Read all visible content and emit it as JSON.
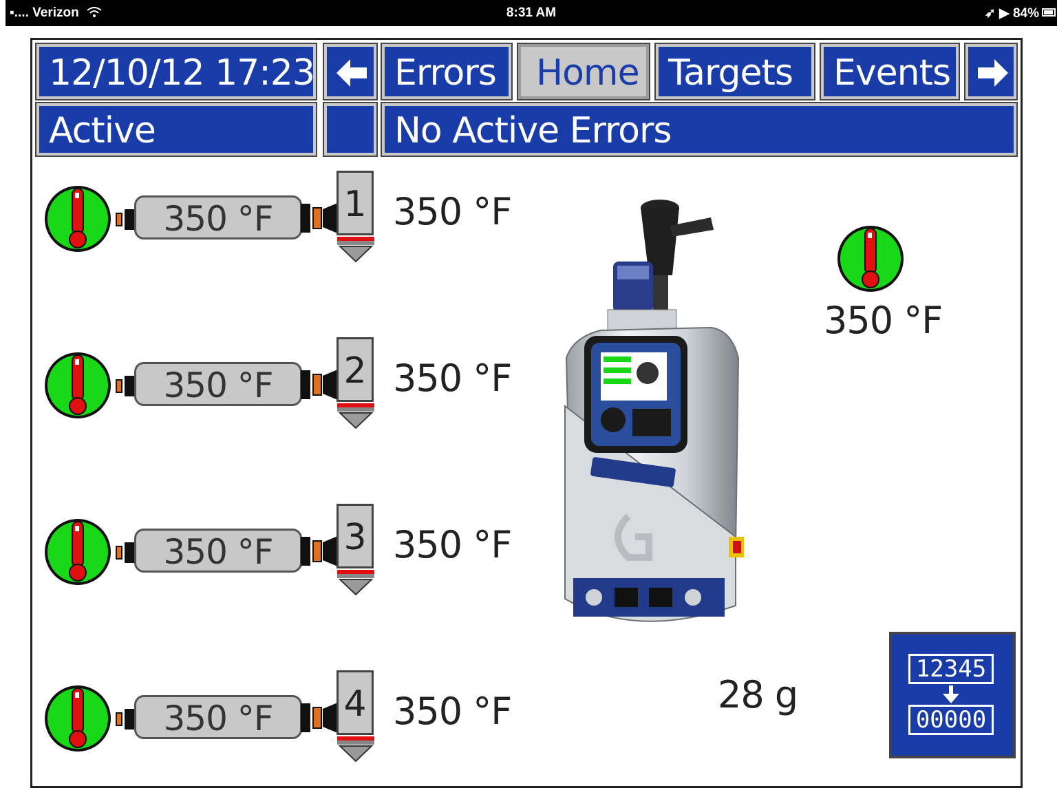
{
  "status_bar": {
    "carrier": "Verizon",
    "time": "8:31 AM",
    "battery": "84%"
  },
  "header": {
    "datetime": "12/10/12 17:23",
    "tabs": [
      "Errors",
      "Home",
      "Targets",
      "Events"
    ],
    "selected_tab": "Home",
    "system_status": "Active",
    "error_status": "No Active Errors"
  },
  "zones": [
    {
      "number": "1",
      "hose_temp": "350 °F",
      "gun_temp": "350 °F"
    },
    {
      "number": "2",
      "hose_temp": "350 °F",
      "gun_temp": "350 °F"
    },
    {
      "number": "3",
      "hose_temp": "350 °F",
      "gun_temp": "350 °F"
    },
    {
      "number": "4",
      "hose_temp": "350 °F",
      "gun_temp": "350 °F"
    }
  ],
  "tank": {
    "temp": "350 °F"
  },
  "material_usage": "28 g",
  "counter": {
    "top": "12345",
    "bottom": "00000"
  },
  "colors": {
    "header_blue": "#1a3ca8",
    "selected_tab": "#c8c8c8",
    "heater_ok_green": "#18d818",
    "thermometer_red": "#e01010"
  },
  "icons": {
    "thermometer": "thermometer-icon",
    "arrow_left": "arrow-left-icon",
    "arrow_right": "arrow-right-icon",
    "reset_counter": "reset-counter-icon"
  }
}
